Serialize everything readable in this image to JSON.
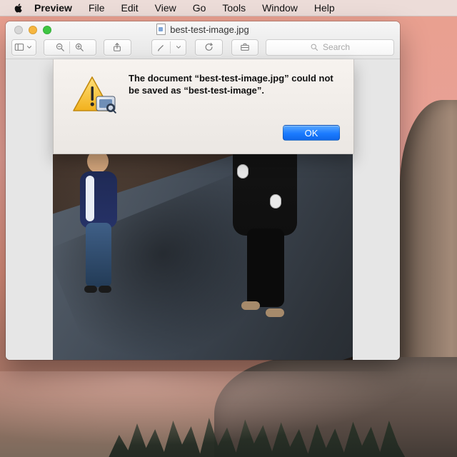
{
  "menubar": {
    "items": [
      "Preview",
      "File",
      "Edit",
      "View",
      "Go",
      "Tools",
      "Window",
      "Help"
    ]
  },
  "window": {
    "title": "best-test-image.jpg",
    "toolbar": {
      "search_placeholder": "Search",
      "icons": [
        "sidebar-icon",
        "zoom-out-icon",
        "zoom-in-icon",
        "share-icon",
        "markup-pen-icon",
        "rotate-icon",
        "toolbox-icon",
        "search-icon"
      ]
    }
  },
  "alert": {
    "message": "The document “best-test-image.jpg” could not be saved as “best-test-image”.",
    "ok_label": "OK"
  },
  "colors": {
    "close": "#d7d7d7",
    "minimize": "#f6b63f",
    "maximize": "#3ec642",
    "ok_button": "#1b7bff"
  }
}
